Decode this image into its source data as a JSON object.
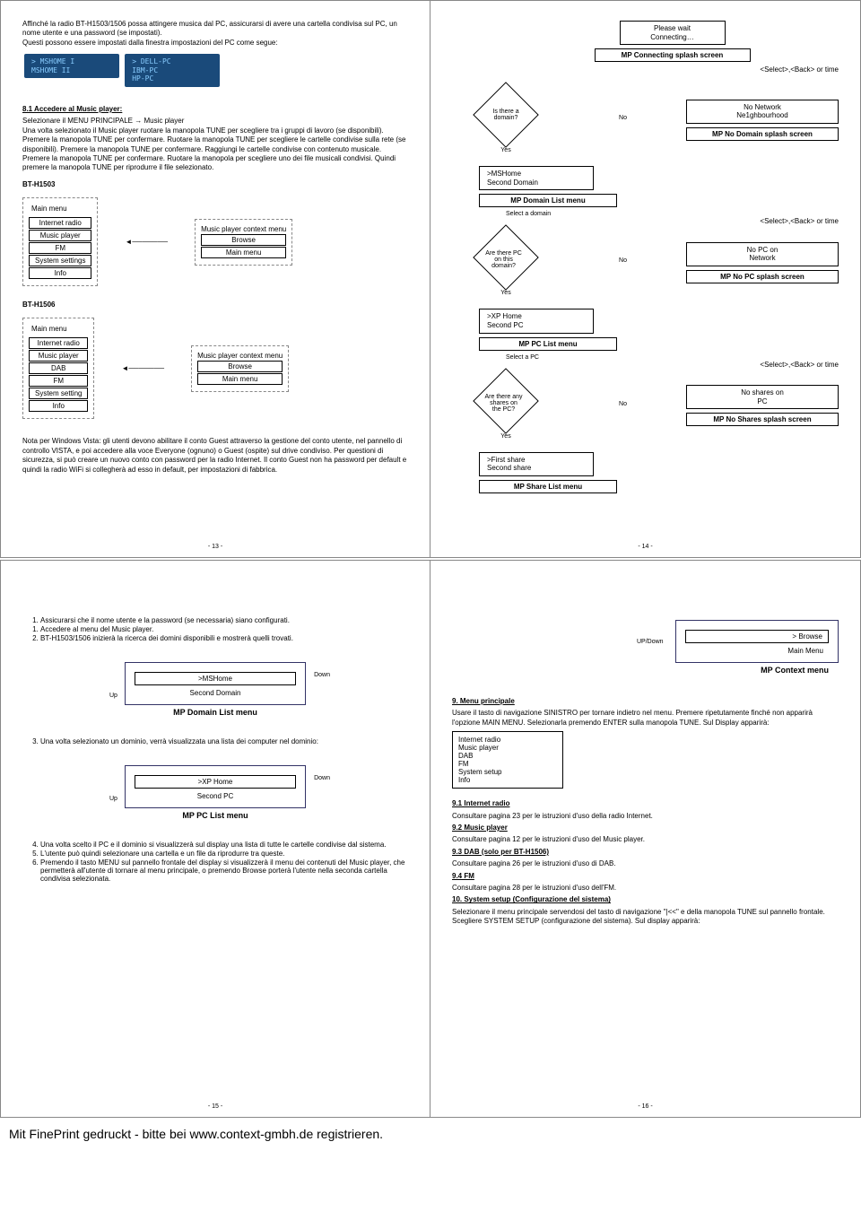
{
  "p13": {
    "intro": "Affinché la radio BT-H1503/1506 possa attingere musica dal PC, assicurarsi di avere una cartella condivisa sul PC, un nome utente e una password (se impostati).\nQuesti possono essere impostati dalla finestra impostazioni del PC come segue:",
    "lcd1a": "> MSHOME I",
    "lcd1b": "MSHOME II",
    "lcd2a": "> DELL-PC",
    "lcd2b": "IBM-PC",
    "lcd2c": "HP-PC",
    "h81": "8.1 Accedere al Music player:",
    "body81": "Selezionare il MENU PRINCIPALE → Music player\nUna volta selezionato il Music player ruotare la manopola TUNE per scegliere tra i gruppi di lavoro (se disponibili). Premere la manopola TUNE per confermare. Ruotare la manopola TUNE per scegliere le cartelle condivise sulla rete (se disponibili). Premere la manopola TUNE per confermare. Raggiungi le cartelle condivise con contenuto musicale. Premere la manopola TUNE per confermare. Ruotare la manopola per scegliere uno dei file musicali condivisi. Quindi premere la manopola TUNE per riprodurre il file selezionato.",
    "m1503": "BT-H1503",
    "m1506": "BT-H1506",
    "mainmenu": "Main menu",
    "mm1": [
      "Internet radio",
      "Music player",
      "FM",
      "System settings",
      "Info"
    ],
    "mm2": [
      "Internet radio",
      "Music player",
      "DAB",
      "FM",
      "System setting",
      "Info"
    ],
    "ctxTitle": "Music player context menu",
    "ctxItems": [
      "Browse",
      "Main menu"
    ],
    "vista": "Nota per Windows Vista: gli utenti devono abilitare il conto Guest attraverso la gestione del conto utente, nel pannello di controllo VISTA, e poi accedere alla voce Everyone (ognuno) o Guest (ospite) sul drive condiviso. Per questioni di sicurezza, si può creare un nuovo conto con password per la radio Internet. Il conto Guest non ha password per default e quindi la radio WiFi si collegherà ad esso in default, per impostazioni di fabbrica.",
    "pn": "- 13 -"
  },
  "p14": {
    "wait": "Please wait\nConnecting…",
    "waitCap": "MP Connecting splash screen",
    "sel": "<Select>,<Back> or time",
    "d1": "Is there a\ndomain?",
    "no": "No",
    "yes": "Yes",
    "nb": "No Network\nNe1ghbourhood",
    "nbCap": "MP No Domain splash screen",
    "dl": ">MSHome\nSecond Domain",
    "dlCap": "MP Domain List menu",
    "seld": "Select a domain",
    "d2": "Are there PC\non this\ndomain?",
    "nopc": "No PC on\nNetwork",
    "nopcCap": "MP No PC splash screen",
    "pcl": ">XP Home\nSecond PC",
    "pclCap": "MP PC List menu",
    "selpc": "Select a PC",
    "d3": "Are there any\nshares on\nthe PC?",
    "nos": "No shares on\nPC",
    "nosCap": "MP No Shares splash screen",
    "shl": ">First share\nSecond share",
    "shlCap": "MP Share List menu",
    "pn": "- 14 -"
  },
  "p15": {
    "l1": "Assicurarsi che il nome utente e la password (se necessaria) siano configurati.",
    "l1b": "Accedere al menu del Music player.",
    "l2": "BT-H1503/1506 inizierà la ricerca dei domini disponibili e mostrerà quelli trovati.",
    "box1a": ">MSHome",
    "box1b": "Second Domain",
    "box1cap": "MP Domain List menu",
    "up": "Up",
    "down": "Down",
    "l3": "Una volta selezionato un dominio, verrà visualizzata una lista dei computer nel dominio:",
    "box2a": ">XP Home",
    "box2b": "Second PC",
    "box2cap": "MP PC List menu",
    "l4": "Una volta scelto il PC e il dominio si visualizzerà sul display una lista di tutte le cartelle condivise dal sistema.",
    "l5": "L'utente può quindi selezionare una cartella e un file da riprodurre tra queste.",
    "l6": "Premendo il tasto MENU sul pannello frontale del display si visualizzerà il menu dei contenuti del Music player, che permetterà all'utente di tornare al menu principale, o premendo Browse porterà l'utente nella seconda cartella condivisa selezionata.",
    "pn": "- 15 -"
  },
  "p16": {
    "ctxBrowse": "> Browse",
    "ctxMain": "Main Menu",
    "ctxCap": "MP Context menu",
    "updown": "UP/Down",
    "h9": "9. Menu principale",
    "b9": "Usare il tasto di navigazione SINISTRO per tornare indietro nel menu. Premere ripetutamente finché non apparirà l'opzione MAIN MENU. Selezionarla premendo ENTER sulla manopola TUNE. Sul Display apparirà:",
    "menuItems": "Internet radio\nMusic player\nDAB\nFM\nSystem setup\nInfo",
    "h91": "9.1 Internet radio",
    "b91": "Consultare pagina 23 per le istruzioni d'uso della radio Internet.",
    "h92": "9.2 Music player",
    "b92": "Consultare pagina 12 per le istruzioni d'uso del Music player.",
    "h93": "9.3 DAB (solo per BT-H1506)",
    "b93": "Consultare pagina 26 per le istruzioni d'uso di DAB.",
    "h94": "9.4 FM",
    "b94": "Consultare pagina 28 per le istruzioni d'uso dell'FM.",
    "h10": "10. System setup (Configurazione del sistema)",
    "b10": "Selezionare il menu principale servendosi del tasto di navigazione \"|<<\" e della manopola TUNE sul pannello frontale. Scegliere SYSTEM SETUP (configurazione del sistema). Sul display apparirà:",
    "pn": "- 16 -"
  },
  "footer": "Mit FinePrint gedruckt - bitte bei www.context-gmbh.de registrieren."
}
